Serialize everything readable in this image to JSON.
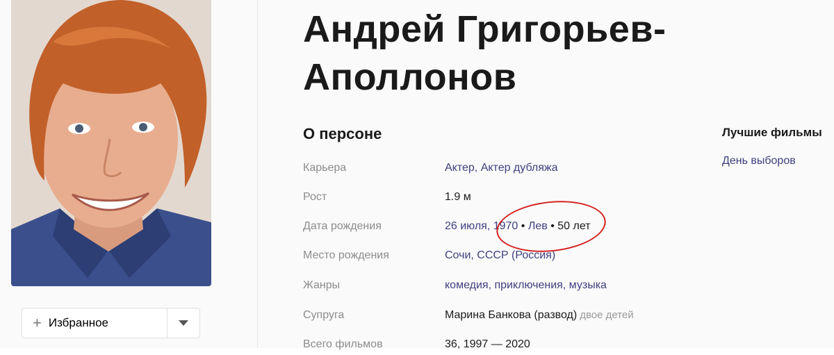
{
  "person": {
    "name_line1": "Андрей Григорьев-",
    "name_line2": "Аполлонов"
  },
  "favorite": {
    "plus": "+",
    "label": "Избранное"
  },
  "about": {
    "title": "О персоне",
    "rows": [
      {
        "label": "Карьера",
        "value": "Актер, Актер дубляжа"
      },
      {
        "label": "Рост",
        "value": "1.9 м"
      },
      {
        "label": "Дата рождения",
        "date": "26 июля,",
        "year": "1970",
        "sep1": "•",
        "sign": "Лев",
        "sep2": "•",
        "age": "50 лет"
      },
      {
        "label": "Место рождения",
        "value": "Сочи, СССР (Россия)"
      },
      {
        "label": "Жанры",
        "value": "комедия, приключения, музыка"
      },
      {
        "label": "Супруга",
        "value": "Марина Банкова (развод)",
        "note": "двое детей"
      },
      {
        "label": "Всего фильмов",
        "count": "36,",
        "years": "1997 — 2020"
      }
    ]
  },
  "best_films": {
    "title": "Лучшие фильмы",
    "items": [
      "День выборов"
    ]
  },
  "annotation_color": "#d42020",
  "link_color": "#3f3f80"
}
